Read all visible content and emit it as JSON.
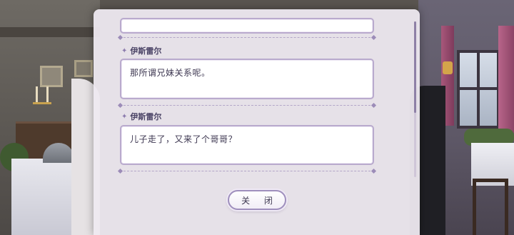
{
  "dialog_log": {
    "entries": [
      {
        "speaker": "",
        "text": ""
      },
      {
        "speaker": "伊斯雷尔",
        "text": "那所谓兄妹关系呢。"
      },
      {
        "speaker": "伊斯雷尔",
        "text": "儿子走了，又来了个哥哥？"
      }
    ],
    "close_label": "关 闭",
    "speaker_marker_icon": "sparkle-icon"
  },
  "colors": {
    "panel_bg": "#eee9f0",
    "box_border": "#b9aacd",
    "accent": "#9f8fbd",
    "text": "#3c3650"
  }
}
